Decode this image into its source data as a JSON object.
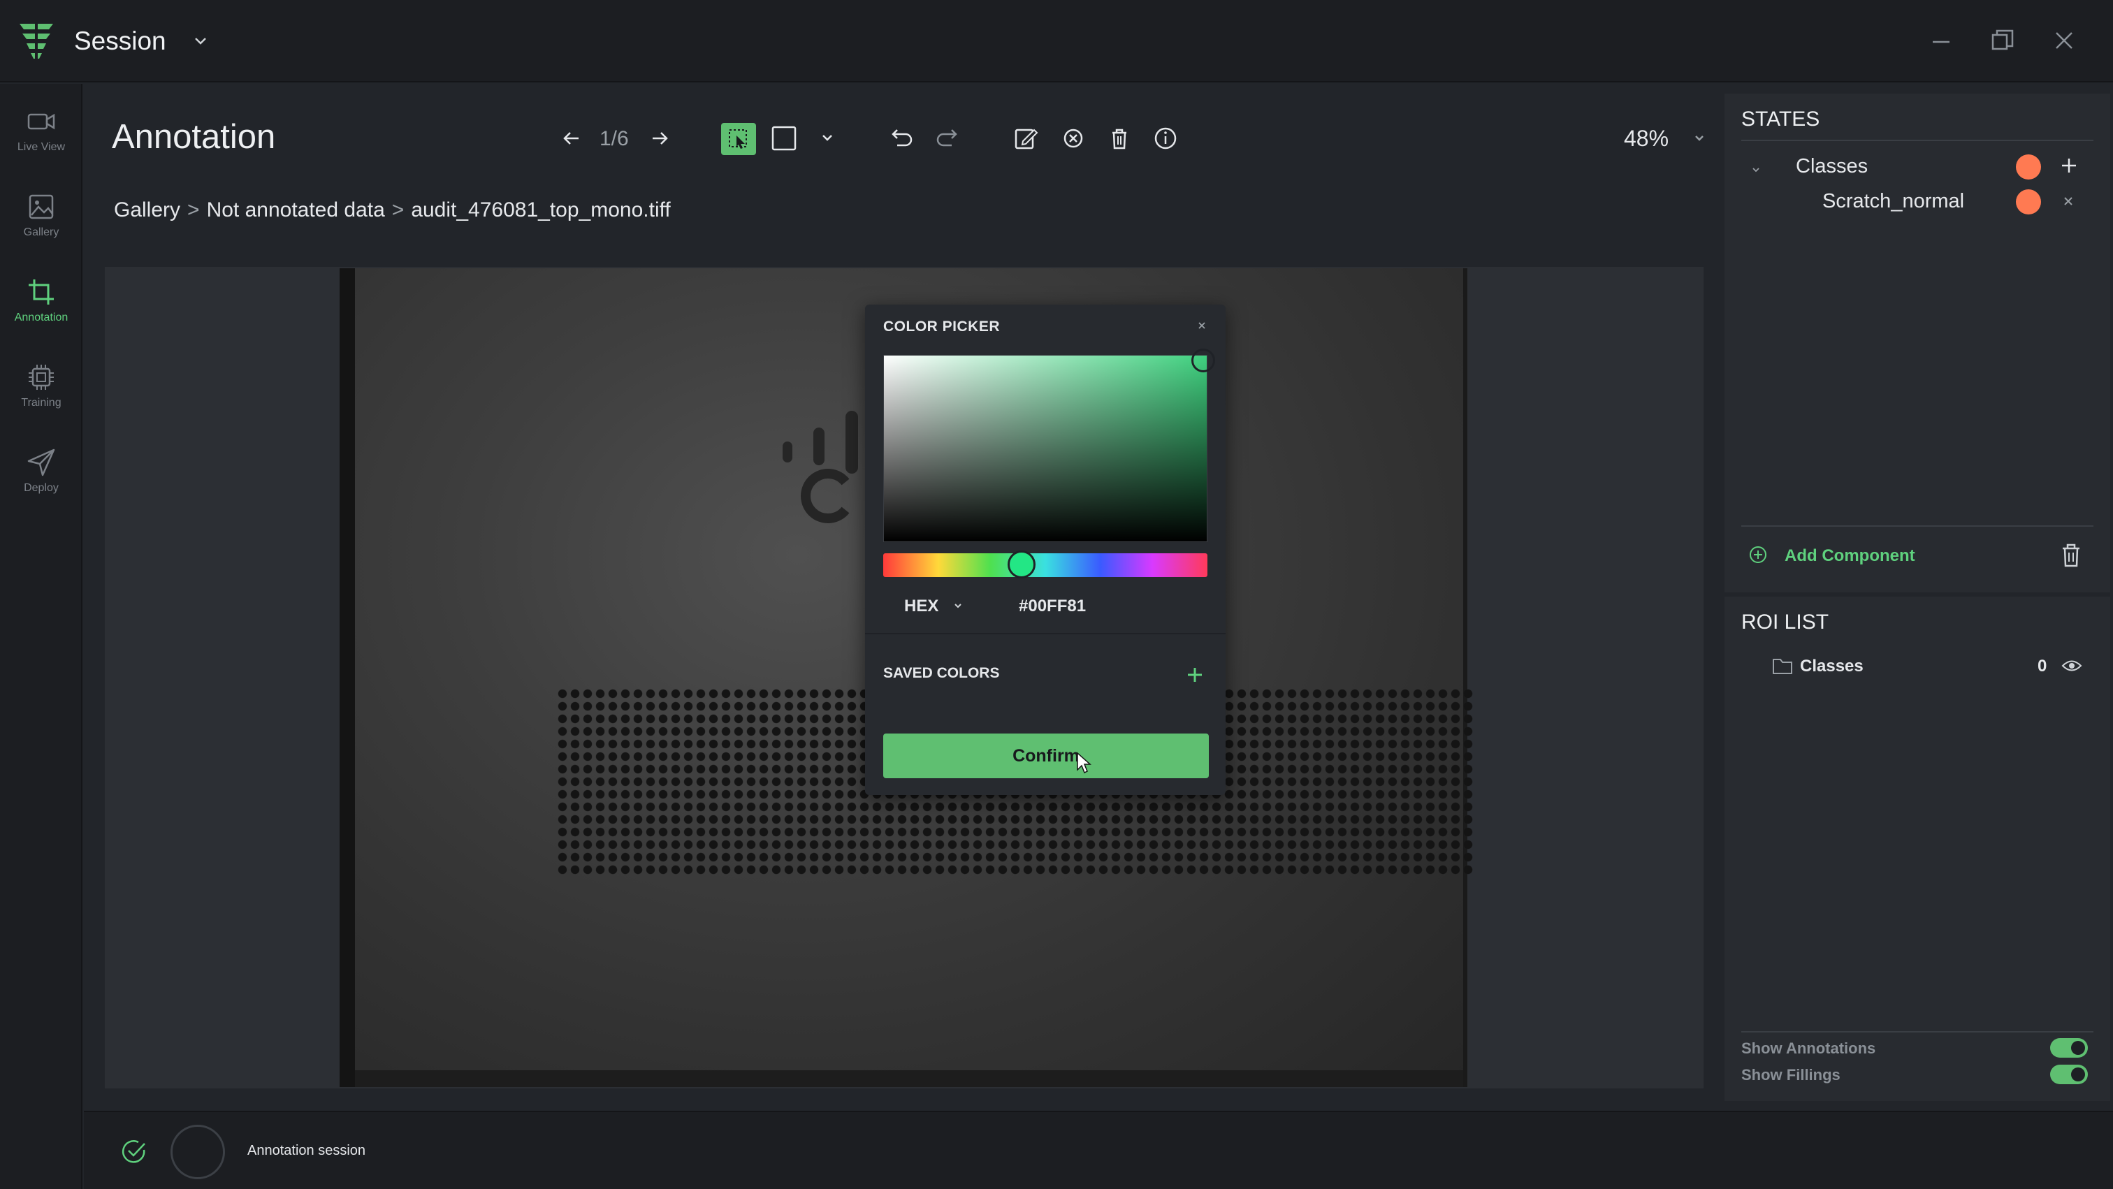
{
  "app": {
    "session_title": "Session"
  },
  "nav": {
    "items": [
      {
        "label": "Live View",
        "icon": "video-camera-icon"
      },
      {
        "label": "Gallery",
        "icon": "image-icon"
      },
      {
        "label": "Annotation",
        "icon": "crop-icon",
        "active": true
      },
      {
        "label": "Training",
        "icon": "chip-icon"
      },
      {
        "label": "Deploy",
        "icon": "send-icon"
      }
    ]
  },
  "main": {
    "title": "Annotation",
    "page_counter": "1/6",
    "zoom": "48%",
    "breadcrumb": [
      "Gallery",
      "Not annotated data",
      "audit_476081_top_mono.tiff"
    ],
    "breadcrumb_separator": ">"
  },
  "color_picker": {
    "title": "COLOR PICKER",
    "mode": "HEX",
    "value": "#00FF81",
    "saved_colors_label": "SAVED COLORS",
    "confirm_label": "Confirm"
  },
  "states": {
    "heading": "STATES",
    "group": {
      "label": "Classes",
      "color": "#ff7a52"
    },
    "items": [
      {
        "label": "Scratch_normal",
        "color": "#ff7a52"
      }
    ],
    "add_component_label": "Add Component"
  },
  "roi": {
    "heading": "ROI LIST",
    "items": [
      {
        "label": "Classes",
        "count": "0"
      }
    ],
    "toggles": [
      {
        "label": "Show Annotations",
        "on": true
      },
      {
        "label": "Show Fillings",
        "on": true
      }
    ]
  },
  "status": {
    "text": "Annotation session"
  },
  "colors": {
    "accent": "#5fbf71",
    "class_color": "#ff7a52",
    "background": "#22252a"
  }
}
